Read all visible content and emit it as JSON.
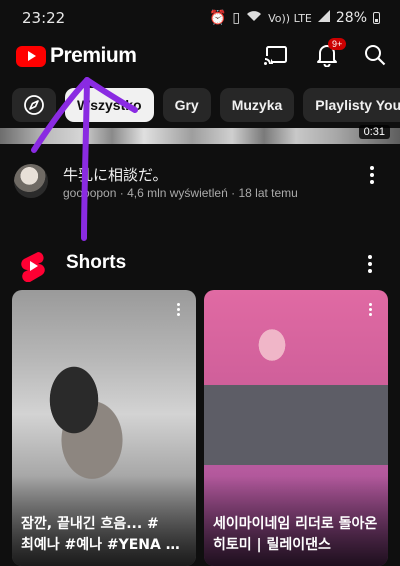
{
  "status_bar": {
    "time": "23:22",
    "network_label": "Vo)) LTE",
    "battery": "28%",
    "icons": [
      "alarm-icon",
      "vibrate-icon",
      "wifi-icon",
      "signal-icon",
      "battery-icon"
    ]
  },
  "app_bar": {
    "logo_text": "Premium",
    "notification_badge": "9+",
    "icons": [
      "cast-icon",
      "bell-icon",
      "search-icon"
    ]
  },
  "chips": [
    {
      "label": "Wszystko",
      "active": true
    },
    {
      "label": "Gry",
      "active": false
    },
    {
      "label": "Muzyka",
      "active": false
    },
    {
      "label": "Playlisty You",
      "active": false
    }
  ],
  "video": {
    "duration": "0:31",
    "title": "牛乳に相談だ。",
    "channel": "goooopon",
    "views": "4,6 mln wyświetleń",
    "age": "18 lat temu",
    "separator": "·"
  },
  "shorts": {
    "section_title": "Shorts",
    "items": [
      {
        "caption_line1": "잠깐, 끝내긴 흐음... #",
        "caption_line2": "최예나 #예나 #YENA #B..."
      },
      {
        "caption_line1": "세이마이네임 리더로 돌아온",
        "caption_line2": "히토미 | 릴레이댄스"
      }
    ]
  },
  "colors": {
    "background": "#0f0f0f",
    "brand_red": "#ff0000",
    "chip_bg": "#272727",
    "chip_active_bg": "#f1f1f1",
    "annotation_purple": "#8a2be2"
  }
}
